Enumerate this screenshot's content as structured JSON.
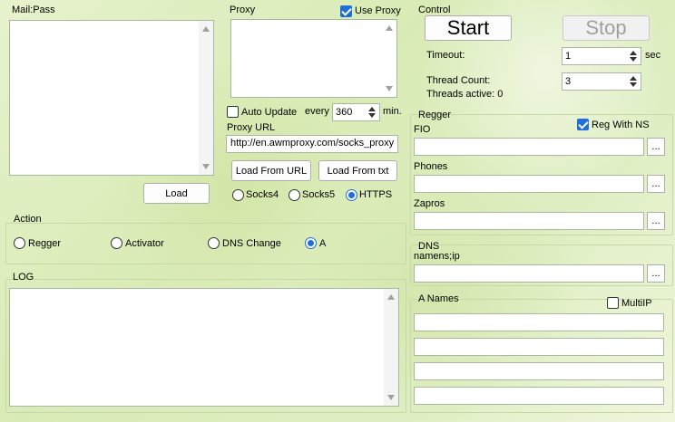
{
  "mailpass": {
    "title": "Mail:Pass",
    "load_label": "Load"
  },
  "proxy": {
    "title": "Proxy",
    "use_proxy_label": "Use Proxy",
    "use_proxy_checked": true,
    "auto_update_label": "Auto Update",
    "auto_update_checked": false,
    "every_label": "every",
    "every_value": "360",
    "min_label": "min.",
    "url_label": "Proxy URL",
    "url_value": "http://en.awmproxy.com/socks_proxy",
    "load_from_url": "Load From URL",
    "load_from_txt": "Load From txt",
    "types": [
      "Socks4",
      "Socks5",
      "HTTPS"
    ],
    "selected_type": "HTTPS"
  },
  "control": {
    "title": "Control",
    "start_label": "Start",
    "stop_label": "Stop",
    "timeout_label": "Timeout:",
    "timeout_value": "1",
    "sec_label": "sec",
    "thread_count_label": "Thread Count:",
    "thread_count_value": "3",
    "threads_active_label": "Threads active: 0"
  },
  "action": {
    "title": "Action",
    "options": [
      "Regger",
      "Activator",
      "DNS Change",
      "A"
    ],
    "selected": "A"
  },
  "log": {
    "title": "LOG"
  },
  "regger": {
    "title": "Regger",
    "reg_with_ns_label": "Reg With NS",
    "reg_with_ns_checked": true,
    "fio_label": "FIO",
    "phones_label": "Phones",
    "zapros_label": "Zapros",
    "browse_label": "..."
  },
  "dns": {
    "title": "DNS",
    "namens_label": "namens;ip",
    "browse_label": "..."
  },
  "anames": {
    "title": "A Names",
    "multiip_label": "MultiIP",
    "multiip_checked": false
  }
}
